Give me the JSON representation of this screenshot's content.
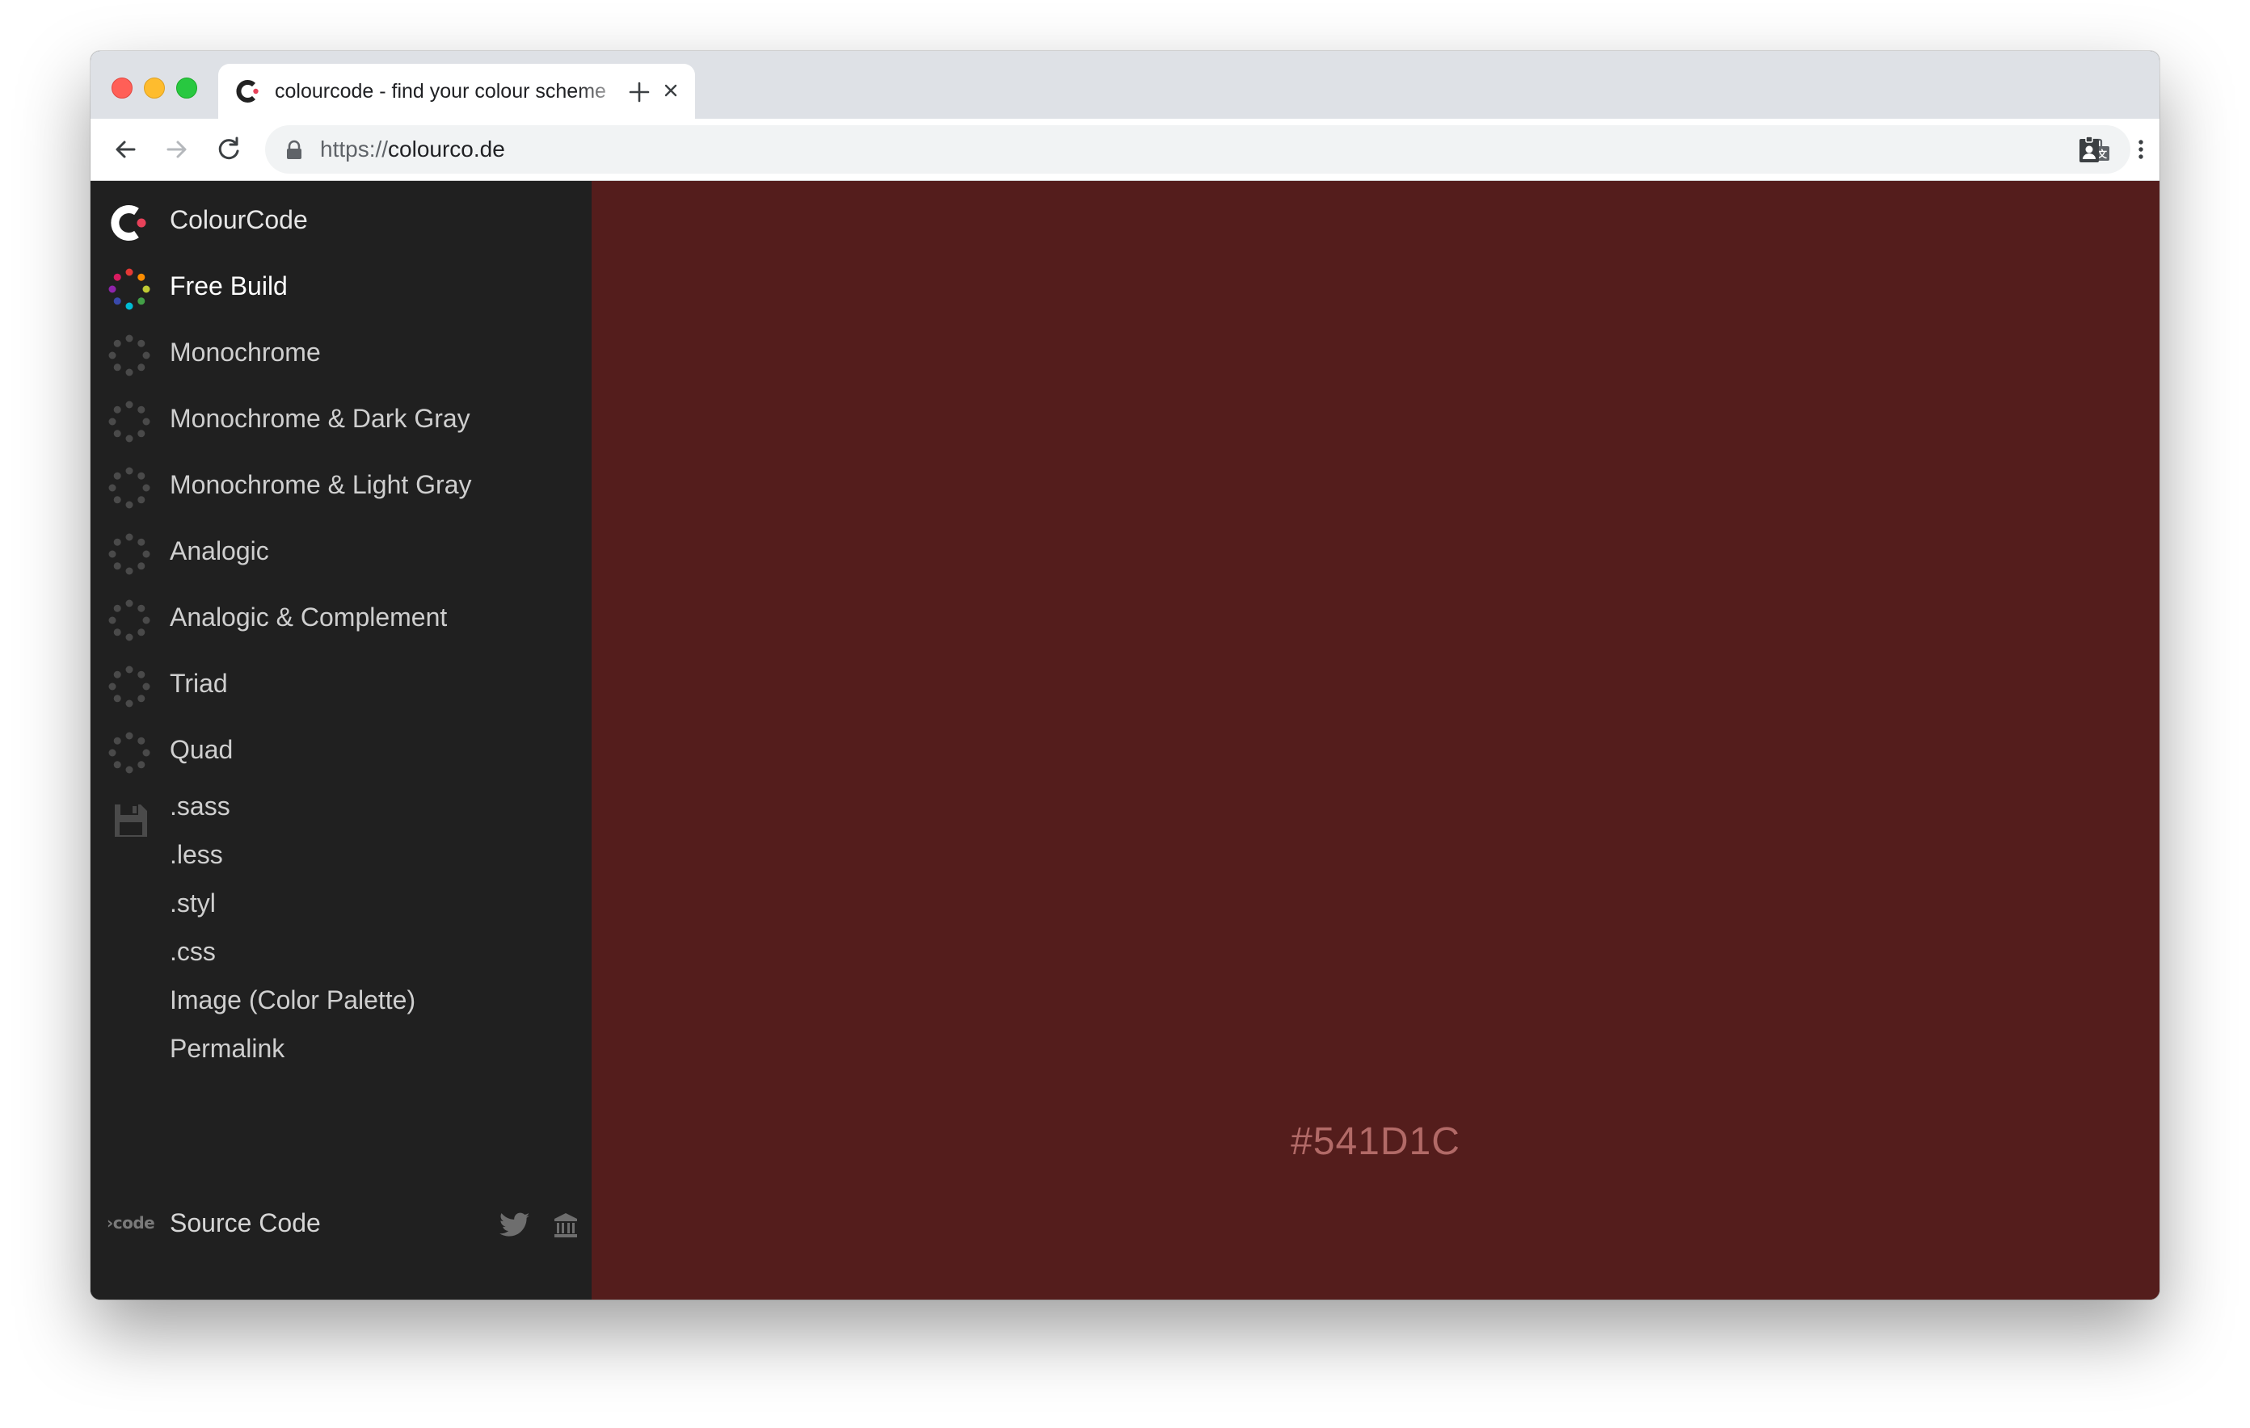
{
  "browser": {
    "tab_title": "colourcode - find your colour scheme",
    "url_scheme": "https://",
    "url_host": "colourco.de",
    "icons": [
      "back-arrow-icon",
      "forward-arrow-icon",
      "reload-icon",
      "lock-icon",
      "translate-icon",
      "profile-badge-icon",
      "kebab-menu-icon",
      "close-icon",
      "plus-icon"
    ]
  },
  "sidebar": {
    "brand": "ColourCode",
    "modes": [
      {
        "label": "Free Build",
        "active": true
      },
      {
        "label": "Monochrome",
        "active": false
      },
      {
        "label": "Monochrome & Dark Gray",
        "active": false
      },
      {
        "label": "Monochrome & Light Gray",
        "active": false
      },
      {
        "label": "Analogic",
        "active": false
      },
      {
        "label": "Analogic & Complement",
        "active": false
      },
      {
        "label": "Triad",
        "active": false
      },
      {
        "label": "Quad",
        "active": false
      }
    ],
    "exports": [
      ".sass",
      ".less",
      ".styl",
      ".css",
      "Image (Color Palette)",
      "Permalink"
    ],
    "footer": {
      "code_mark": "›code",
      "source_label": "Source Code"
    }
  },
  "main": {
    "color_hex": "#541D1C",
    "background": "#541d1c"
  },
  "colors": {
    "sidebar_bg": "#202020",
    "tab_strip_bg": "#dee1e6",
    "hex_text": "#b26a67"
  }
}
